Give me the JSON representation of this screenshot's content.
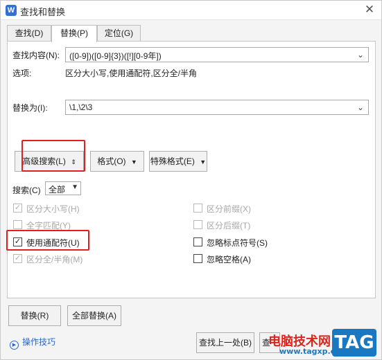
{
  "window": {
    "title": "查找和替换",
    "app_icon": "W",
    "close_glyph": "✕",
    "app_icon_color": "#2f6fd6"
  },
  "tabs": [
    {
      "label": "查找(D)"
    },
    {
      "label": "替换(P)",
      "active": true
    },
    {
      "label": "定位(G)"
    }
  ],
  "find": {
    "label": "查找内容(N):",
    "value": "([0-9])([0-9]{3})([!][0-9年])"
  },
  "options": {
    "label": "选项:",
    "value": "区分大小写,使用通配符,区分全/半角"
  },
  "replace": {
    "label": "替换为(I):",
    "value": "\\1,\\2\\3"
  },
  "buttons": {
    "advanced": "高级搜索(L)",
    "advanced_glyph": "⇕",
    "format": "格式(O)",
    "special": "特殊格式(E)",
    "caret": "▼",
    "replace": "替换(R)",
    "replace_all": "全部替换(A)",
    "find_prev": "查找上一处(B)",
    "find_next_partial": "查"
  },
  "search": {
    "label": "搜索(C)",
    "value": "全部"
  },
  "checkboxes": {
    "match_case": {
      "label": "区分大小写(H)",
      "checked": true,
      "enabled": false
    },
    "whole_word": {
      "label": "全字匹配(Y)",
      "checked": false,
      "enabled": false
    },
    "wildcards": {
      "label": "使用通配符(U)",
      "checked": true,
      "enabled": true
    },
    "width": {
      "label": "区分全/半角(M)",
      "checked": true,
      "enabled": false
    },
    "prefix": {
      "label": "区分前缀(X)",
      "checked": false,
      "enabled": false
    },
    "suffix": {
      "label": "区分后缀(T)",
      "checked": false,
      "enabled": false
    },
    "ignore_punct": {
      "label": "忽略标点符号(S)",
      "checked": false,
      "enabled": true
    },
    "ignore_space": {
      "label": "忽略空格(A)",
      "checked": false,
      "enabled": true
    }
  },
  "tips": {
    "label": "操作技巧"
  },
  "watermark": {
    "site_cn": "电脑技术网",
    "site_url": "www.tagxp.com",
    "logo": "TAG",
    "red": "#d9261c",
    "blue": "#1a78c2"
  },
  "colors": {
    "highlight_box": "#e02020",
    "link": "#2d66c9"
  }
}
